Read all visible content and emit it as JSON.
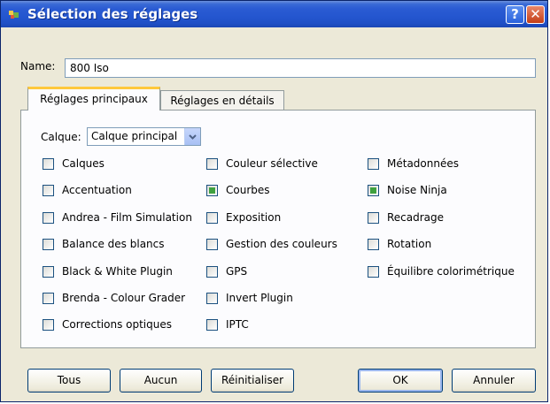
{
  "window": {
    "title": "Sélection des réglages",
    "help_label": "?",
    "close_label": "✕",
    "title_icon": "app-icon"
  },
  "name": {
    "label": "Name:",
    "value": "800 Iso"
  },
  "tabs": [
    {
      "label": "Réglages principaux",
      "active": true
    },
    {
      "label": "Réglages en détails",
      "active": false
    }
  ],
  "calque": {
    "label": "Calque:",
    "selected": "Calque principal"
  },
  "columns": [
    [
      {
        "label": " Calques",
        "checked": false
      },
      {
        "label": "Accentuation",
        "checked": false
      },
      {
        "label": "Andrea - Film Simulation",
        "checked": false
      },
      {
        "label": "Balance des blancs",
        "checked": false
      },
      {
        "label": "Black & White Plugin",
        "checked": false
      },
      {
        "label": "Brenda - Colour Grader",
        "checked": false
      },
      {
        "label": "Corrections optiques",
        "checked": false
      }
    ],
    [
      {
        "label": "Couleur sélective",
        "checked": false
      },
      {
        "label": "Courbes",
        "checked": true
      },
      {
        "label": "Exposition",
        "checked": false
      },
      {
        "label": "Gestion des couleurs",
        "checked": false
      },
      {
        "label": "GPS",
        "checked": false
      },
      {
        "label": "Invert Plugin",
        "checked": false
      },
      {
        "label": "IPTC",
        "checked": false
      }
    ],
    [
      {
        "label": "Métadonnées",
        "checked": false
      },
      {
        "label": "Noise Ninja",
        "checked": true
      },
      {
        "label": "Recadrage",
        "checked": false
      },
      {
        "label": "Rotation",
        "checked": false
      },
      {
        "label": "Équilibre colorimétrique",
        "checked": false
      }
    ]
  ],
  "buttons": {
    "all": "Tous",
    "none": "Aucun",
    "reset": "Réinitialiser",
    "ok": "OK",
    "cancel": "Annuler"
  },
  "colors": {
    "titlebar": "#2456cf",
    "dialog_bg": "#ece9d8",
    "tab_highlight": "#ffc83c",
    "check_fill": "#3fa13f"
  }
}
